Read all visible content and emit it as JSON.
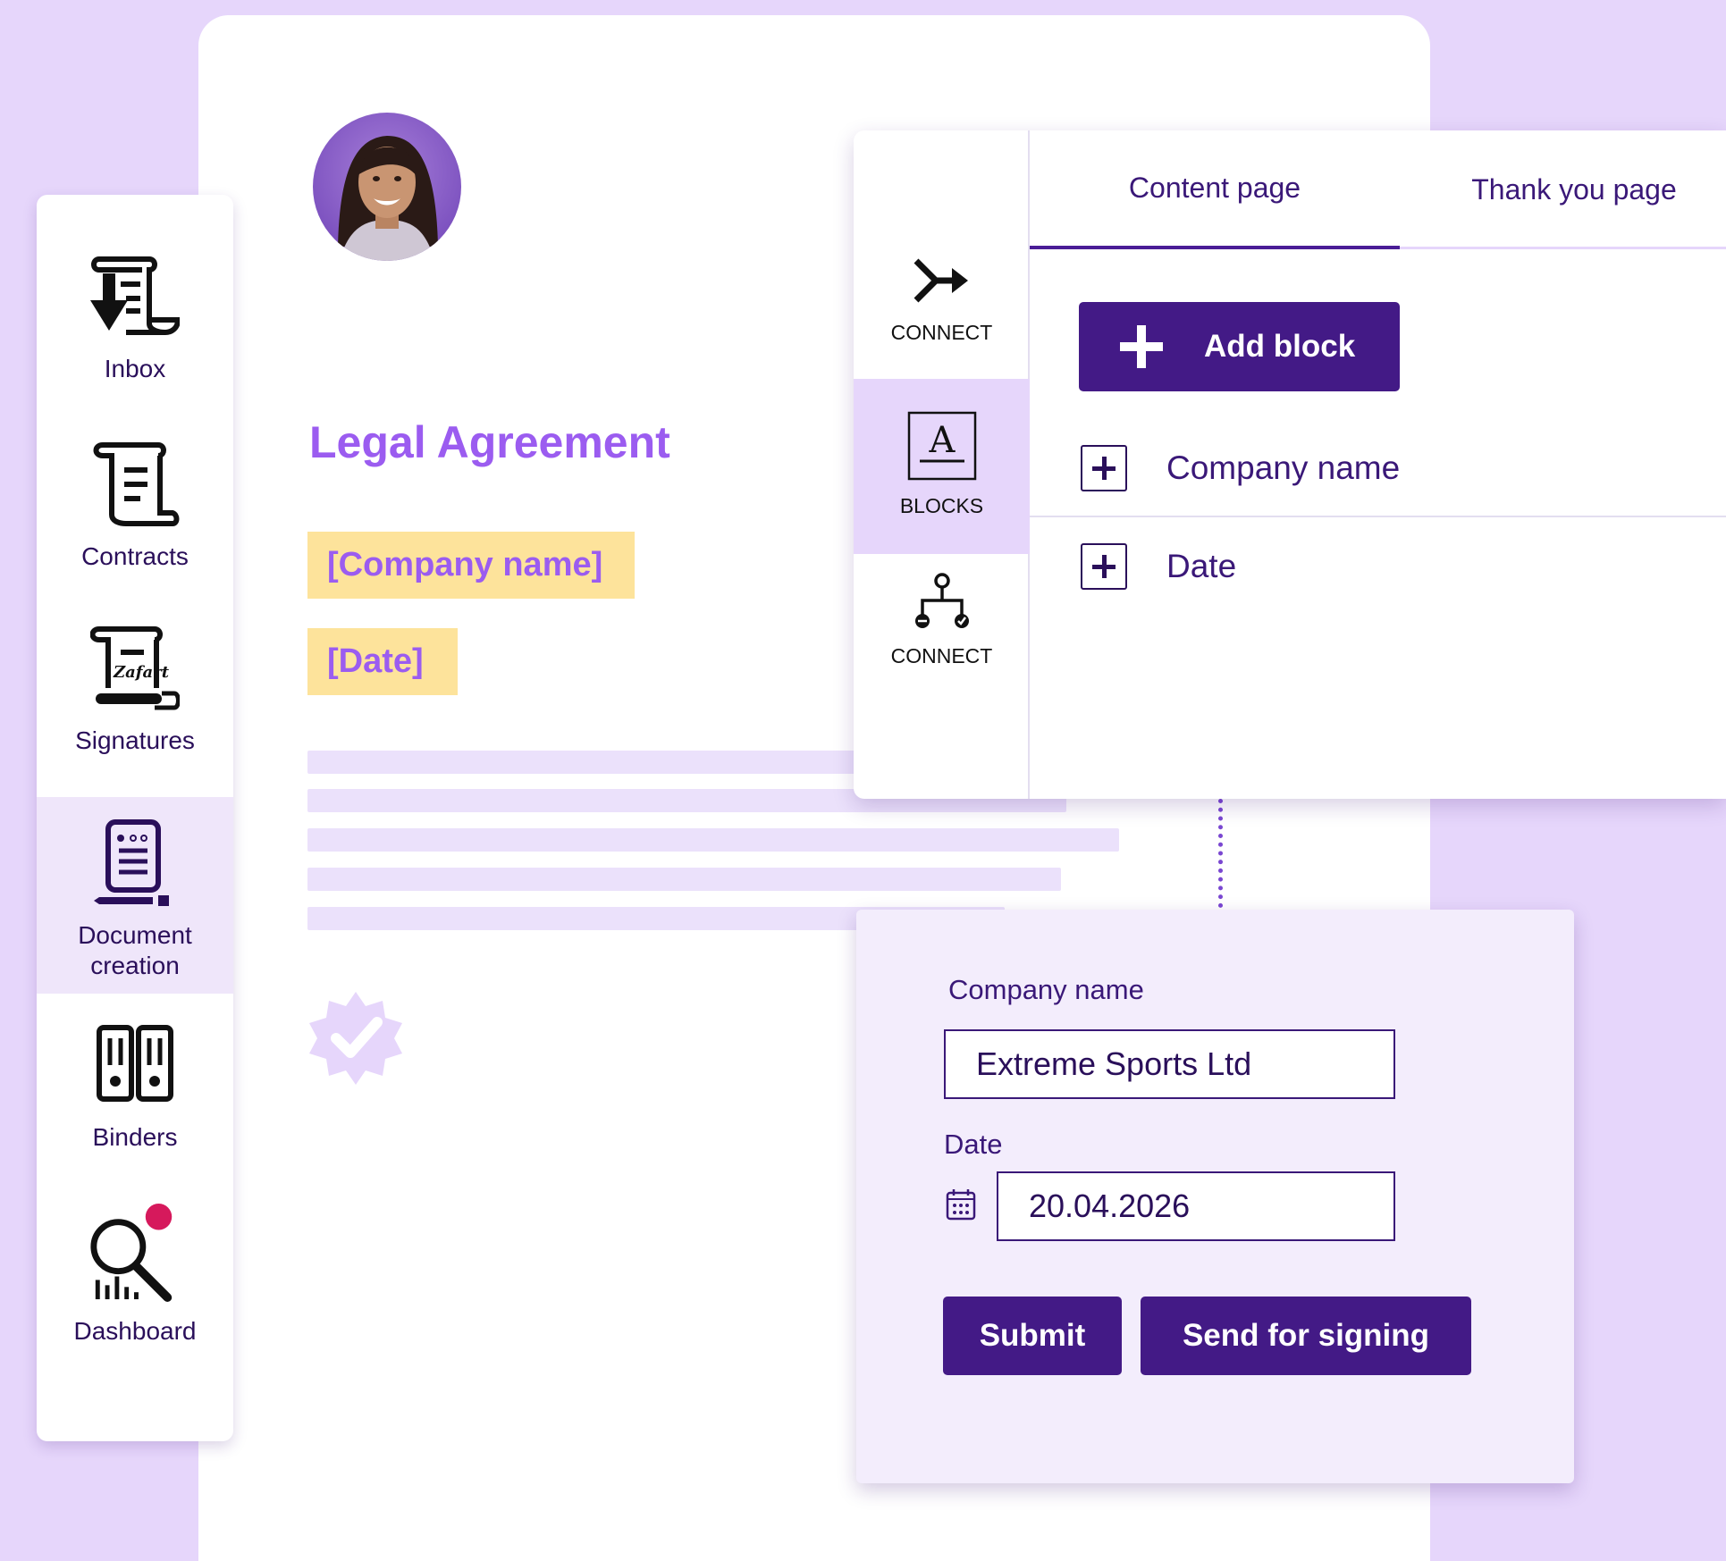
{
  "sidebar": {
    "items": [
      {
        "label": "Inbox",
        "icon": "inbox-icon"
      },
      {
        "label": "Contracts",
        "icon": "contract-scroll-icon"
      },
      {
        "label": "Signatures",
        "icon": "signature-scroll-icon"
      },
      {
        "label": "Document creation",
        "icon": "document-creation-icon",
        "active": true
      },
      {
        "label": "Binders",
        "icon": "binders-icon"
      },
      {
        "label": "Dashboard",
        "icon": "dashboard-search-icon"
      }
    ]
  },
  "document": {
    "title": "Legal Agreement",
    "placeholder_company": "[Company name]",
    "placeholder_date": "[Date]"
  },
  "editor": {
    "side_items": [
      {
        "label": "CONNECT",
        "icon": "merge-arrows-icon"
      },
      {
        "label": "BLOCKS",
        "icon": "text-block-icon",
        "active": true
      },
      {
        "label": "CONNECT",
        "icon": "workflow-tree-icon"
      }
    ],
    "tabs": [
      {
        "label": "Content page",
        "active": true
      },
      {
        "label": "Thank you page"
      }
    ],
    "add_block_label": "Add block",
    "blocks": [
      {
        "label": "Company name"
      },
      {
        "label": "Date"
      }
    ]
  },
  "form": {
    "company_label": "Company name",
    "company_value": "Extreme Sports Ltd",
    "date_label": "Date",
    "date_value": "20.04.2026",
    "submit_label": "Submit",
    "send_label": "Send for signing"
  },
  "colors": {
    "background": "#e6d6fb",
    "primary": "#431a86",
    "accent": "#9b5cf0",
    "highlight": "#fde39b",
    "notification_dot": "#d6195c"
  }
}
